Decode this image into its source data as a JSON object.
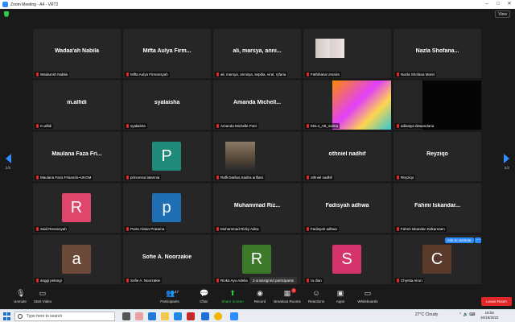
{
  "window": {
    "title": "Zoom Meeting - A4 - VRT2",
    "view_label": "View"
  },
  "pagination": {
    "left": "2/2",
    "right": "2/2"
  },
  "tiles": [
    {
      "big": "Wadaa'ah Nabila",
      "caption": "Wadaa'ah Nabila"
    },
    {
      "big": "Mifta Aulya Firm...",
      "caption": "Mifta Aulya Firmansyah"
    },
    {
      "big": "ali, marsya, anni...",
      "caption": "ali, marsya, annisya, sepdia, viral, ryfaria"
    },
    {
      "big": "",
      "caption": "Fathihana Umaira"
    },
    {
      "big": "Nazla Shofana...",
      "caption": "Nazla Shofana Monri"
    },
    {
      "big": "m.alfidi",
      "caption": "m.alfidi"
    },
    {
      "big": "syalaisha",
      "caption": "syalaisha"
    },
    {
      "big": "Amanda Michell...",
      "caption": "Amanda Michelle Putri"
    },
    {
      "big": "",
      "caption": "KEL4_AB_salma"
    },
    {
      "big": "",
      "caption": "adisatya dewandana"
    },
    {
      "big": "Maulana Faza Fri...",
      "caption": "Maulana Faza Frisando~UKGM"
    },
    {
      "big": "",
      "caption": "princessa latannia",
      "avatar": "P",
      "color": "#1f8a7a"
    },
    {
      "big": "",
      "caption": "Rafli Darlius,Sadira arifiani"
    },
    {
      "big": "othniel nadhif",
      "caption": "othniel nadhif"
    },
    {
      "big": "Reyziqo",
      "caption": "Reyziqo"
    },
    {
      "big": "",
      "caption": "Said Revansyah",
      "avatar": "R",
      "color": "#e0456b"
    },
    {
      "big": "",
      "caption": "Putra Alvian Pratama",
      "avatar": "p",
      "color": "#1f6fb5"
    },
    {
      "big": "Muhammad Riz...",
      "caption": "Muhammad Rizky Adira"
    },
    {
      "big": "Fadisyah adhwa",
      "caption": "Fadisyah adhwa"
    },
    {
      "big": "Fahmi Iskandar...",
      "caption": "Fahmi Iskandar Zulkarnaen"
    },
    {
      "big": "",
      "caption": "anggi pelangi",
      "avatar": "a",
      "color": "#6b4a3a"
    },
    {
      "big": "Sofie A. Noorzakie",
      "caption": "Sofie A. Noorzakie"
    },
    {
      "big": "",
      "caption": "Rioka Ayu Adelia",
      "avatar": "R",
      "color": "#3c7a2a"
    },
    {
      "big": "",
      "caption": "ra dian",
      "avatar": "S",
      "color": "#d4336b"
    },
    {
      "big": "",
      "caption": "Chyntia Airun",
      "avatar": "C",
      "color": "#5a3a2a"
    }
  ],
  "ask_unmute": "Ask to Unmute",
  "ask_more": "...",
  "unassigned": "3 unassigned participants",
  "toolbar": {
    "unmute": "Unmute",
    "start_video": "Start Video",
    "participants": "Participants",
    "participants_count": "47",
    "chat": "Chat",
    "share_screen": "Share Screen",
    "record": "Record",
    "breakout_rooms": "Breakout Rooms",
    "breakout_badge": "3",
    "reactions": "Reactions",
    "apps": "Apps",
    "whiteboards": "Whiteboards",
    "leave": "Leave Room"
  },
  "taskbar": {
    "search_placeholder": "Type here to search",
    "weather": "27°C  Cloudy",
    "time": "18:55",
    "date": "10/18/2022"
  }
}
